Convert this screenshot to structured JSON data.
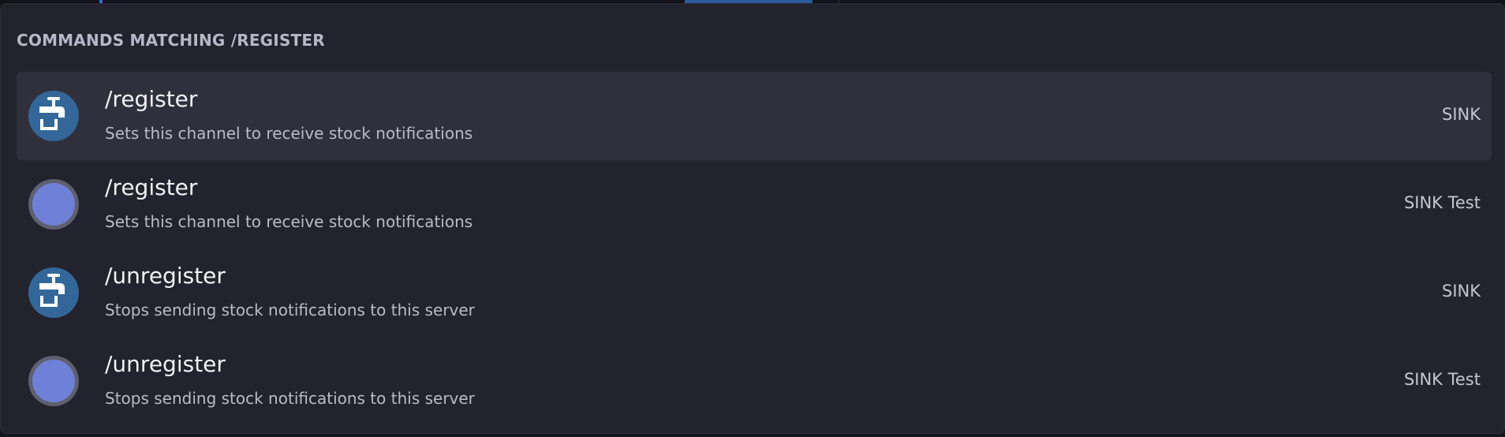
{
  "panel": {
    "title": "COMMANDS MATCHING /REGISTER"
  },
  "commands": [
    {
      "name": "/register",
      "description": "Sets this channel to receive stock notifications",
      "source": "SINK",
      "icon": "faucet-icon",
      "selected": true
    },
    {
      "name": "/register",
      "description": "Sets this channel to receive stock notifications",
      "source": "SINK Test",
      "icon": "default-app-icon",
      "selected": false
    },
    {
      "name": "/unregister",
      "description": "Stops sending stock notifications to this server",
      "source": "SINK",
      "icon": "faucet-icon",
      "selected": false
    },
    {
      "name": "/unregister",
      "description": "Stops sending stock notifications to this server",
      "source": "SINK Test",
      "icon": "default-app-icon",
      "selected": false
    }
  ],
  "colors": {
    "panel_bg": "#23232d",
    "selected_row_bg": "#30303d",
    "sink_avatar": "#336799",
    "test_avatar": "#6f80d8"
  }
}
